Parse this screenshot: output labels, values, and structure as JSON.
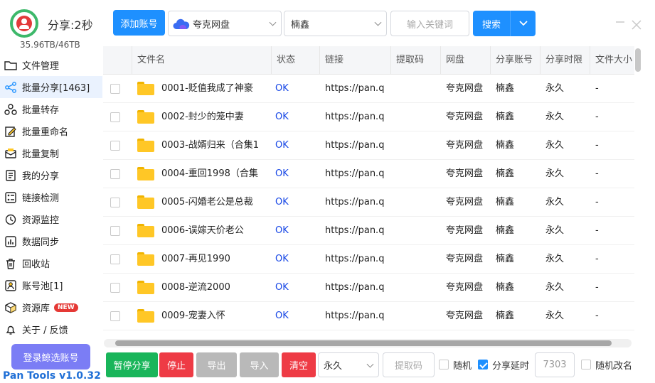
{
  "header": {
    "share_speed": "分享:2秒",
    "storage": "35.96TB/46TB"
  },
  "sidebar": {
    "items": [
      {
        "label": "文件管理",
        "icon": "folder-icon"
      },
      {
        "label": "批量分享[1463]",
        "icon": "share-icon",
        "active": true
      },
      {
        "label": "批量转存",
        "icon": "transfer-icon"
      },
      {
        "label": "批量重命名",
        "icon": "rename-icon"
      },
      {
        "label": "批量复制",
        "icon": "copy-icon"
      },
      {
        "label": "我的分享",
        "icon": "my-share-icon"
      },
      {
        "label": "链接检测",
        "icon": "link-check-icon"
      },
      {
        "label": "资源监控",
        "icon": "monitor-icon"
      },
      {
        "label": "数据同步",
        "icon": "sync-icon"
      },
      {
        "label": "回收站",
        "icon": "trash-icon"
      },
      {
        "label": "账号池[1]",
        "icon": "account-pool-icon"
      },
      {
        "label": "资源库",
        "icon": "library-icon",
        "badge": "NEW"
      },
      {
        "label": "关于 / 反馈",
        "icon": "bell-icon"
      }
    ],
    "login_button": "登录鲸选账号",
    "version": "Pan Tools v1.0.32"
  },
  "toolbar": {
    "add_account": "添加账号",
    "disk_select": "夸克网盘",
    "account_select": "楠鑫",
    "search_placeholder": "输入关键词",
    "search_button": "搜索"
  },
  "table": {
    "columns": [
      "文件名",
      "状态",
      "链接",
      "提取码",
      "网盘",
      "分享账号",
      "分享时限",
      "文件大小"
    ],
    "rows": [
      {
        "name": "0001-贬值我成了神豪",
        "status": "OK",
        "link": "https://pan.q",
        "code": "",
        "disk": "夸克网盘",
        "account": "楠鑫",
        "limit": "永久",
        "size": "-"
      },
      {
        "name": "0002-封少的笼中妻",
        "status": "OK",
        "link": "https://pan.q",
        "code": "",
        "disk": "夸克网盘",
        "account": "楠鑫",
        "limit": "永久",
        "size": "-"
      },
      {
        "name": "0003-战婿归来（合集1",
        "status": "OK",
        "link": "https://pan.q",
        "code": "",
        "disk": "夸克网盘",
        "account": "楠鑫",
        "limit": "永久",
        "size": "-"
      },
      {
        "name": "0004-重回1998（合集",
        "status": "OK",
        "link": "https://pan.q",
        "code": "",
        "disk": "夸克网盘",
        "account": "楠鑫",
        "limit": "永久",
        "size": "-"
      },
      {
        "name": "0005-闪婚老公是总裁",
        "status": "OK",
        "link": "https://pan.q",
        "code": "",
        "disk": "夸克网盘",
        "account": "楠鑫",
        "limit": "永久",
        "size": "-"
      },
      {
        "name": "0006-误嫁天价老公",
        "status": "OK",
        "link": "https://pan.q",
        "code": "",
        "disk": "夸克网盘",
        "account": "楠鑫",
        "limit": "永久",
        "size": "-"
      },
      {
        "name": "0007-再见1990",
        "status": "OK",
        "link": "https://pan.q",
        "code": "",
        "disk": "夸克网盘",
        "account": "楠鑫",
        "limit": "永久",
        "size": "-"
      },
      {
        "name": "0008-逆流2000",
        "status": "OK",
        "link": "https://pan.q",
        "code": "",
        "disk": "夸克网盘",
        "account": "楠鑫",
        "limit": "永久",
        "size": "-"
      },
      {
        "name": "0009-宠妻入怀",
        "status": "OK",
        "link": "https://pan.q",
        "code": "",
        "disk": "夸克网盘",
        "account": "楠鑫",
        "limit": "永久",
        "size": "-"
      }
    ]
  },
  "bottom": {
    "pause": "暂停分享",
    "stop": "停止",
    "export": "导出",
    "import": "导入",
    "clear": "清空",
    "limit_select": "永久",
    "code_placeholder": "提取码",
    "random": "随机",
    "delay": "分享延时",
    "delay_value": "7303",
    "random_rename": "随机改名"
  },
  "colors": {
    "accent": "#1e90ff",
    "pause_green": "#19b55a",
    "stop_red": "#ee3b45",
    "disabled_gray": "#b9b9b9",
    "ok_blue": "#1747e6"
  }
}
